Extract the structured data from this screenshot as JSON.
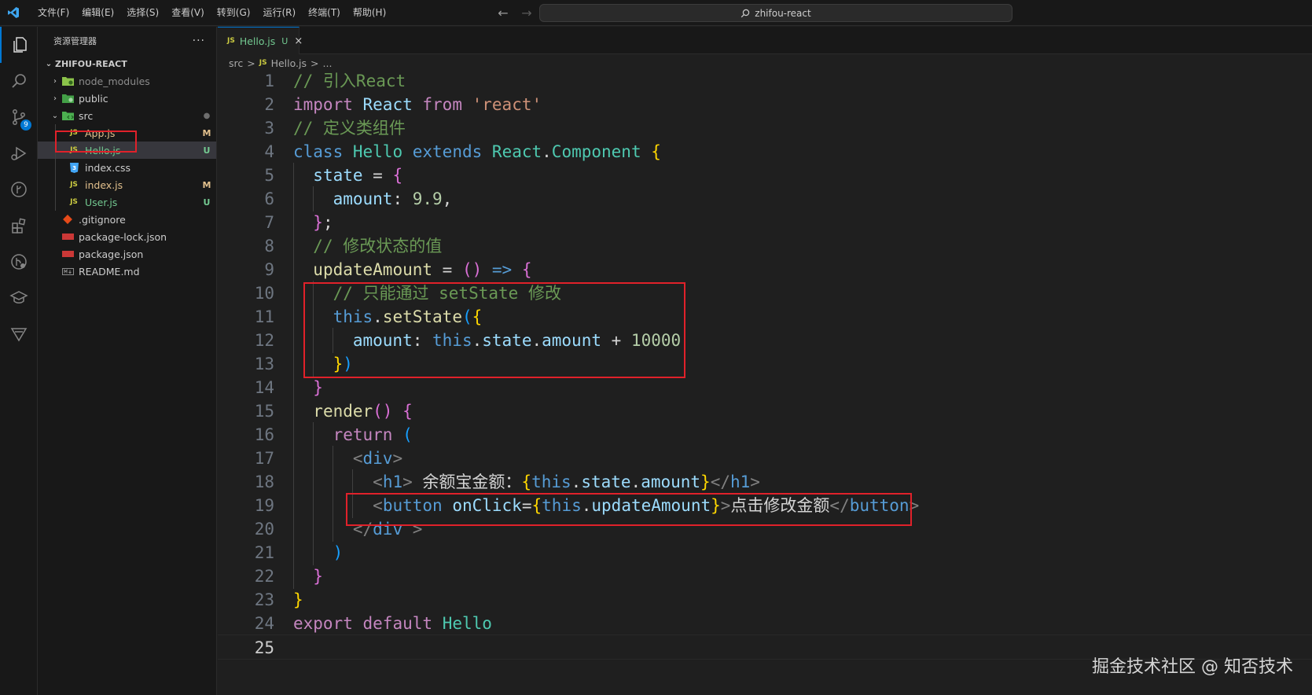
{
  "titlebar": {
    "menus": [
      "文件(F)",
      "编辑(E)",
      "选择(S)",
      "查看(V)",
      "转到(G)",
      "运行(R)",
      "终端(T)",
      "帮助(H)"
    ],
    "search_text": "zhifou-react",
    "back_icon": "←",
    "forward_icon": "→"
  },
  "activity": {
    "source_control_badge": "9"
  },
  "sidebar": {
    "title": "资源管理器",
    "more": "···",
    "project": "ZHIFOU-REACT",
    "items": [
      {
        "name": "node_modules",
        "status": ""
      },
      {
        "name": "public",
        "status": ""
      },
      {
        "name": "src",
        "status": "●"
      },
      {
        "name": "App.js",
        "status": "M"
      },
      {
        "name": "Hello.js",
        "status": "U"
      },
      {
        "name": "index.css",
        "status": ""
      },
      {
        "name": "index.js",
        "status": "M"
      },
      {
        "name": "User.js",
        "status": "U"
      },
      {
        "name": ".gitignore",
        "status": ""
      },
      {
        "name": "package-lock.json",
        "status": ""
      },
      {
        "name": "package.json",
        "status": ""
      },
      {
        "name": "README.md",
        "status": ""
      }
    ]
  },
  "tab": {
    "icon": "JS",
    "name": "Hello.js",
    "status": "U",
    "close": "×"
  },
  "breadcrumb": {
    "folder": "src",
    "sep": ">",
    "icon": "JS",
    "file": "Hello.js",
    "rest": "..."
  },
  "editor": {
    "line_numbers": [
      "1",
      "2",
      "3",
      "4",
      "5",
      "6",
      "7",
      "8",
      "9",
      "10",
      "11",
      "12",
      "13",
      "14",
      "15",
      "16",
      "17",
      "18",
      "19",
      "20",
      "21",
      "22",
      "23",
      "24",
      "25"
    ],
    "code": {
      "l1": "// 引入React",
      "l2_import": "import",
      "l2_react": "React",
      "l2_from": "from",
      "l2_str": "'react'",
      "l3": "// 定义类组件",
      "l4_class": "class",
      "l4_name": "Hello",
      "l4_extends": "extends",
      "l4_react": "React",
      "l4_dot": ".",
      "l4_comp": "Component",
      "l4_brace": "{",
      "l5_state": "state",
      "l5_eq": " = ",
      "l5_brace": "{",
      "l6_amount": "amount",
      "l6_colon": ": ",
      "l6_num": "9.9",
      "l6_comma": ",",
      "l7_brace": "}",
      "l7_semi": ";",
      "l8": "// 修改状态的值",
      "l9_name": "updateAmount",
      "l9_eq": " = ",
      "l9_paren": "()",
      "l9_arrow": "=>",
      "l9_brace": "{",
      "l10": "// 只能通过 setState 修改",
      "l11_this": "this",
      "l11_dot": ".",
      "l11_fn": "setState",
      "l11_paren": "(",
      "l11_brace": "{",
      "l12_amount": "amount",
      "l12_colon": ": ",
      "l12_this": "this",
      "l12_d1": ".",
      "l12_state": "state",
      "l12_d2": ".",
      "l12_amount2": "amount",
      "l12_plus": " + ",
      "l12_num": "10000",
      "l13_brace": "}",
      "l13_paren": ")",
      "l14_brace": "}",
      "l15_fn": "render",
      "l15_paren": "()",
      "l15_brace": "{",
      "l16_return": "return",
      "l16_paren": "(",
      "l17_open": "<",
      "l17_tag": "div",
      "l17_close": ">",
      "l18_open": "<",
      "l18_tag": "h1",
      "l18_close": ">",
      "l18_text": " 余额宝金额：",
      "l18_b1": "{",
      "l18_this": "this",
      "l18_d1": ".",
      "l18_state": "state",
      "l18_d2": ".",
      "l18_amount": "amount",
      "l18_b2": "}",
      "l18_end_open": "</",
      "l18_end_tag": "h1",
      "l18_end_close": ">",
      "l19_open": "<",
      "l19_tag": "button",
      "l19_attr": "onClick",
      "l19_eq": "=",
      "l19_b1": "{",
      "l19_this": "this",
      "l19_dot": ".",
      "l19_fn": "updateAmount",
      "l19_b2": "}",
      "l19_close": ">",
      "l19_text": "点击修改金额",
      "l19_end_open": "</",
      "l19_end_tag": "button",
      "l19_end_close": ">",
      "l20_open": "</",
      "l20_tag": "div",
      "l20_close": " >",
      "l21_paren": ")",
      "l22_brace": "}",
      "l23_brace": "}",
      "l24_export": "export",
      "l24_default": "default",
      "l24_name": "Hello"
    }
  },
  "watermark": "掘金技术社区 @ 知否技术"
}
